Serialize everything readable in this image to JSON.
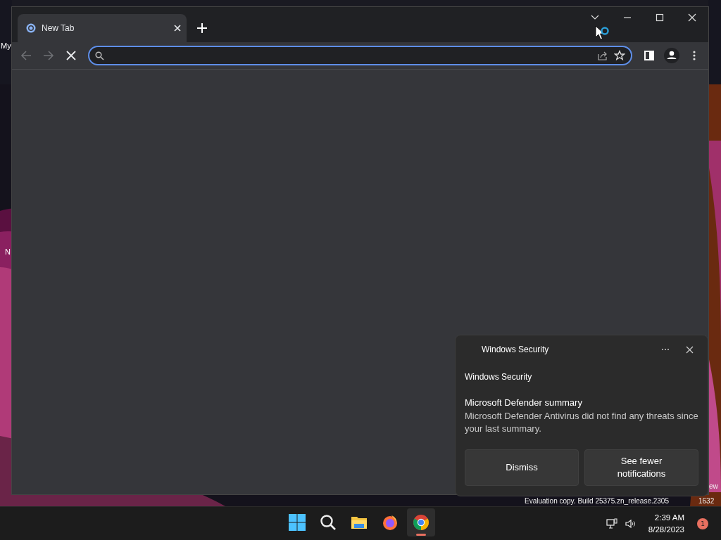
{
  "desktop": {
    "labels": [
      "My",
      "N"
    ],
    "watermark": [
      "ew",
      "Evaluation copy. Build 25375.zn_release.2305",
      "1632"
    ]
  },
  "browser": {
    "tabs": [
      {
        "title": "New Tab",
        "selected": true
      }
    ],
    "nav": {
      "back_enabled": false,
      "forward_enabled": false,
      "loading": true
    }
  },
  "notification": {
    "app": "Windows Security",
    "source": "Windows Security",
    "title": "Microsoft Defender summary",
    "body": "Microsoft Defender Antivirus did not find any threats since your last summary.",
    "buttons": [
      "Dismiss",
      "See fewer notifications"
    ]
  },
  "taskbar": {
    "apps": [
      {
        "kind": "start",
        "selected": false
      },
      {
        "kind": "search",
        "selected": false
      },
      {
        "kind": "files",
        "selected": false
      },
      {
        "kind": "firefox",
        "selected": false
      },
      {
        "kind": "chrome",
        "selected": true
      }
    ],
    "time": "2:39 AM",
    "date": "8/28/2023",
    "badge": "1"
  }
}
